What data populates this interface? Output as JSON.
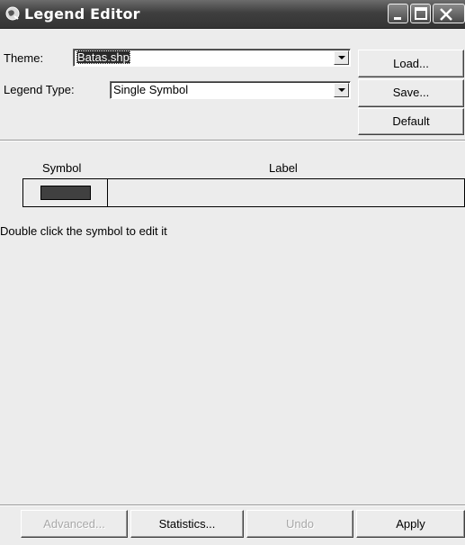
{
  "window": {
    "title": "Legend Editor",
    "icon": "globe-icon"
  },
  "title_buttons": [
    "minimize-icon",
    "maximize-icon",
    "close-icon"
  ],
  "theme": {
    "label": "Theme:",
    "value": "Batas.shp"
  },
  "legend_type": {
    "label": "Legend Type:",
    "value": "Single Symbol"
  },
  "side_buttons": {
    "load": "Load...",
    "save": "Save...",
    "default": "Default"
  },
  "table": {
    "headers": {
      "symbol": "Symbol",
      "label": "Label"
    },
    "rows": [
      {
        "symbol_color": "#404040",
        "label": ""
      }
    ]
  },
  "hint": "Double click the symbol to edit it",
  "bottom_buttons": {
    "advanced": {
      "label": "Advanced...",
      "enabled": false
    },
    "statistics": {
      "label": "Statistics...",
      "enabled": true
    },
    "undo": {
      "label": "Undo",
      "enabled": false
    },
    "apply": {
      "label": "Apply",
      "enabled": true
    }
  }
}
